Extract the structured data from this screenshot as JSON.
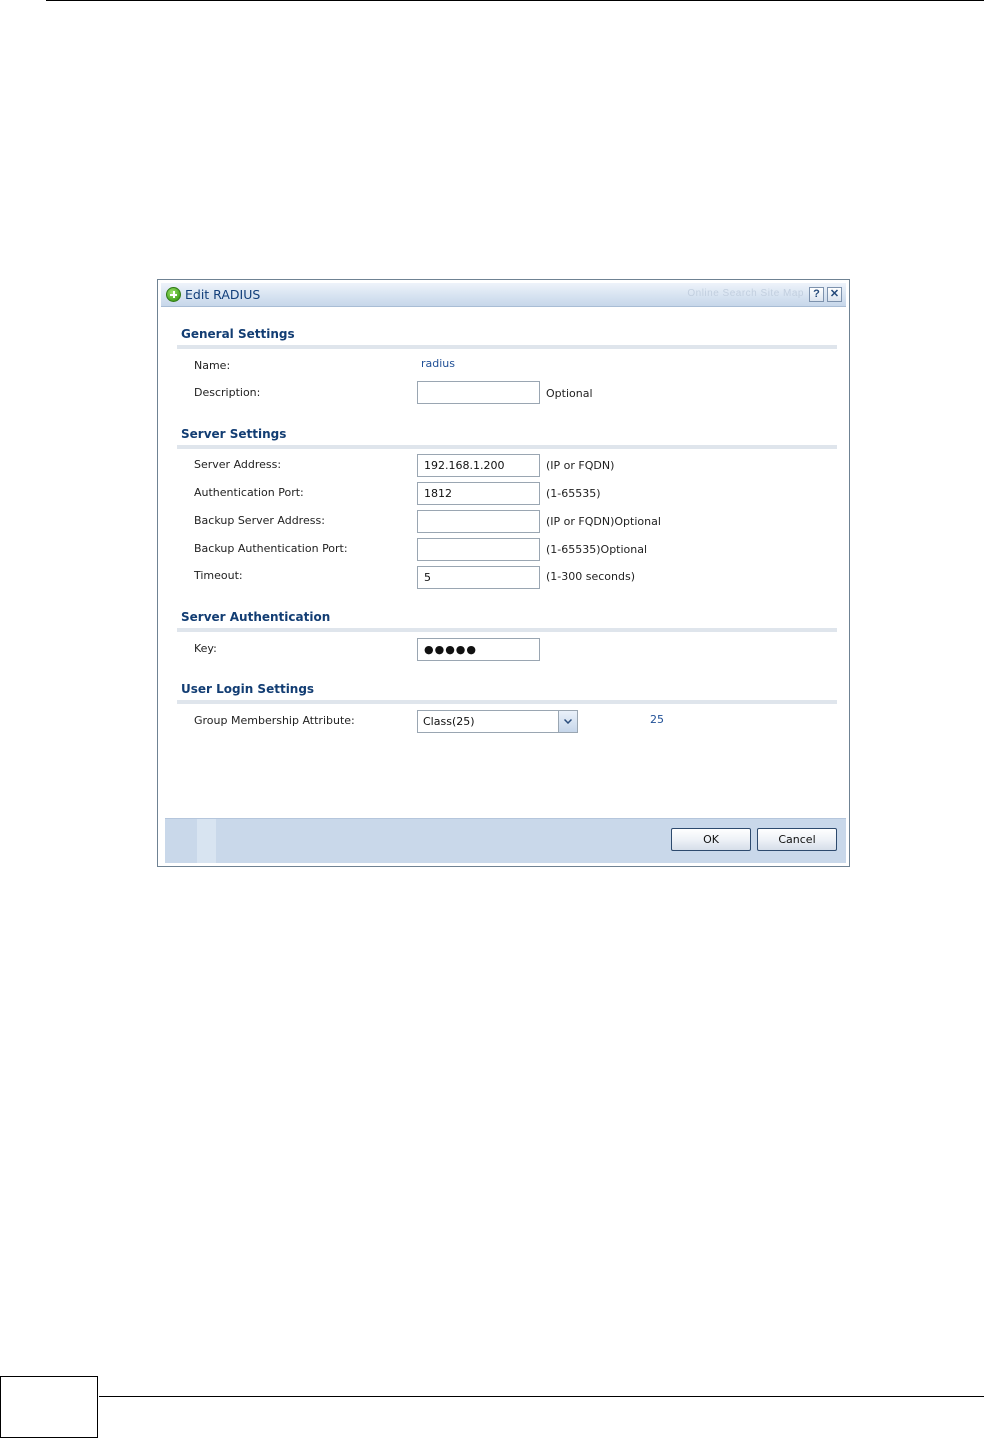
{
  "dialog": {
    "title": "Edit RADIUS",
    "faint_links": "Online   Search   Site Map",
    "help_label": "?",
    "close_label": "✕"
  },
  "general": {
    "header": "General Settings",
    "name_label": "Name:",
    "name_value": "radius",
    "description_label": "Description:",
    "description_value": "",
    "description_hint": "Optional"
  },
  "server": {
    "header": "Server Settings",
    "address_label": "Server Address:",
    "address_value": "192.168.1.200",
    "address_hint": "(IP or FQDN)",
    "auth_port_label": "Authentication Port:",
    "auth_port_value": "1812",
    "auth_port_hint": "(1-65535)",
    "backup_address_label": "Backup Server Address:",
    "backup_address_value": "",
    "backup_address_hint": "(IP or FQDN)Optional",
    "backup_port_label": "Backup Authentication Port:",
    "backup_port_value": "",
    "backup_port_hint": "(1-65535)Optional",
    "timeout_label": "Timeout:",
    "timeout_value": "5",
    "timeout_hint": "(1-300 seconds)"
  },
  "auth": {
    "header": "Server Authentication",
    "key_label": "Key:",
    "key_value": "●●●●●"
  },
  "login": {
    "header": "User Login Settings",
    "group_label": "Group Membership Attribute:",
    "group_selected": "Class(25)",
    "group_value": "25"
  },
  "footer": {
    "ok_label": "OK",
    "cancel_label": "Cancel"
  }
}
